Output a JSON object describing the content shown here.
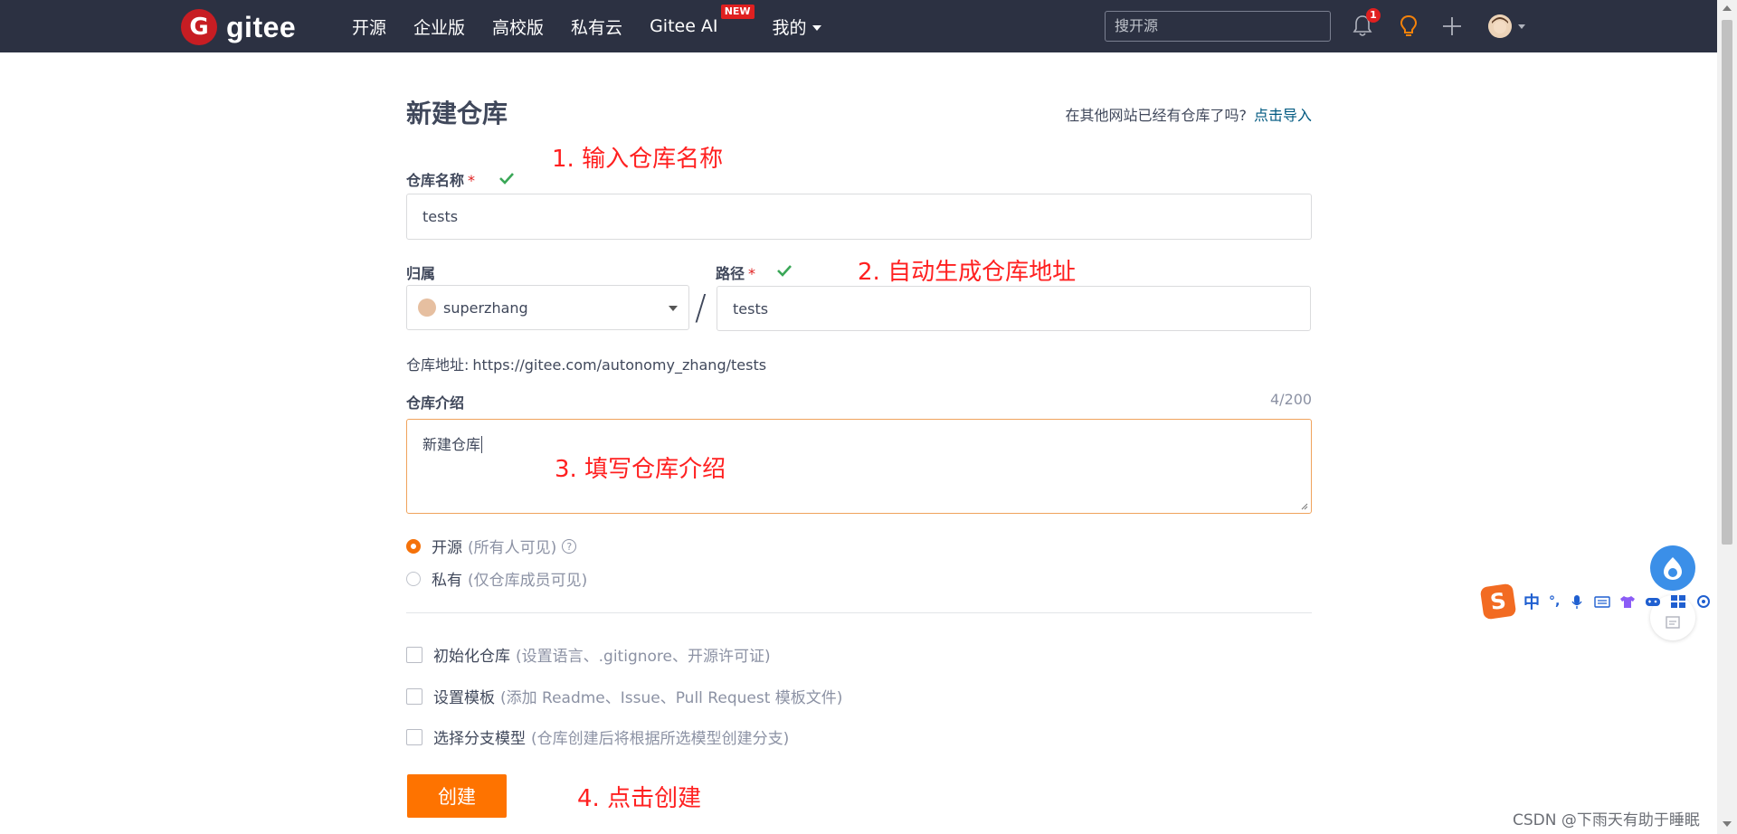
{
  "header": {
    "logo_text": "gitee",
    "logo_mark": "G",
    "nav": [
      {
        "label": "开源"
      },
      {
        "label": "企业版"
      },
      {
        "label": "高校版"
      },
      {
        "label": "私有云"
      },
      {
        "label": "Gitee AI",
        "badge": "NEW"
      },
      {
        "label": "我的"
      }
    ],
    "search_placeholder": "搜开源",
    "notification_count": "1",
    "icons": [
      "bell-icon",
      "lightbulb-icon",
      "plus-icon",
      "avatar"
    ]
  },
  "page": {
    "title": "新建仓库",
    "import_prompt": "在其他网站已经有仓库了吗?",
    "import_link": "点击导入"
  },
  "form": {
    "repo_name_label": "仓库名称",
    "repo_name_value": "tests",
    "owner_label": "归属",
    "owner_value": "superzhang",
    "path_label": "路径",
    "path_value": "tests",
    "separator": "/",
    "required_mark": "*",
    "repo_address_label": "仓库地址:",
    "repo_address_value": "https://gitee.com/autonomy_zhang/tests",
    "intro_label": "仓库介绍",
    "intro_counter": "4/200",
    "intro_value": "新建仓库",
    "visibility": [
      {
        "label": "开源",
        "hint": "(所有人可见)",
        "selected": true,
        "help": "?"
      },
      {
        "label": "私有",
        "hint": "(仅仓库成员可见)",
        "selected": false
      }
    ],
    "options": [
      {
        "label": "初始化仓库",
        "hint": "(设置语言、.gitignore、开源许可证)"
      },
      {
        "label": "设置模板",
        "hint": "(添加 Readme、Issue、Pull Request 模板文件)"
      },
      {
        "label": "选择分支模型",
        "hint": "(仓库创建后将根据所选模型创建分支)"
      }
    ],
    "submit_label": "创建"
  },
  "annotations": [
    "1. 输入仓库名称",
    "2. 自动生成仓库地址",
    "3. 填写仓库介绍",
    "4. 点击创建"
  ],
  "ime_toolbar": {
    "logo": "S",
    "mode": "中",
    "punct": "°,"
  },
  "watermark": "CSDN @下雨天有助于睡眠",
  "colors": {
    "header_bg": "#2c3142",
    "accent": "#fe7300",
    "brand_red": "#c71d23",
    "annotation": "#ff2020",
    "link": "#005980"
  }
}
